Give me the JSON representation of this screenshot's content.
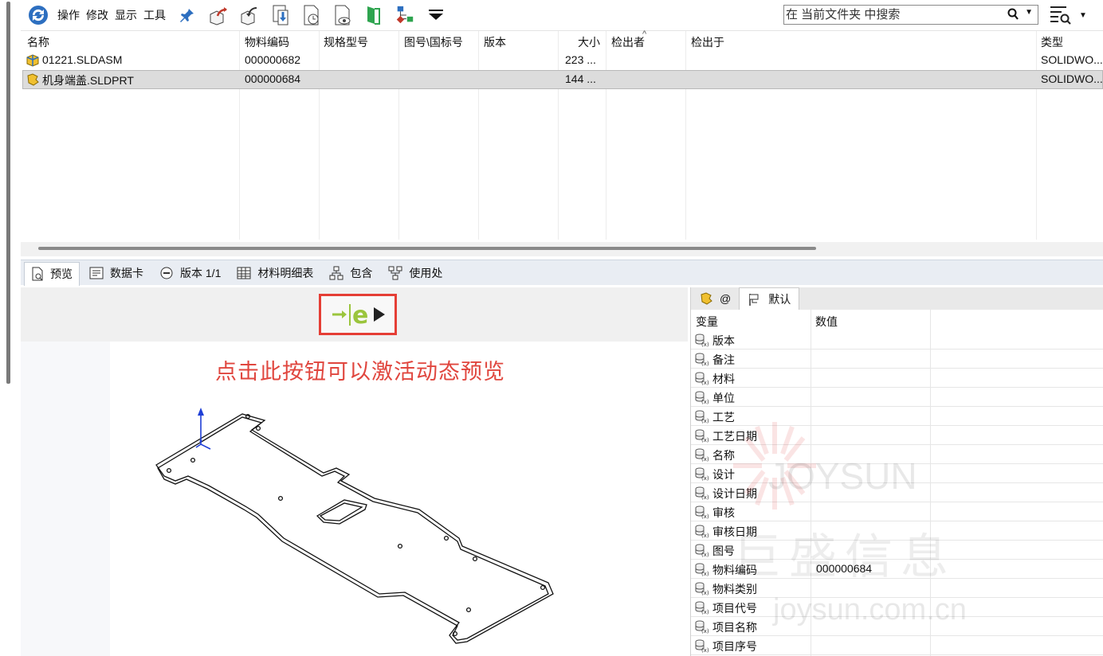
{
  "toolbar": {
    "menus": [
      "操作",
      "修改",
      "显示",
      "工具"
    ],
    "search_placeholder": "在 当前文件夹 中搜索"
  },
  "filelist": {
    "columns": [
      "名称",
      "物料编码",
      "规格型号",
      "图号\\国标号",
      "版本",
      "大小",
      "检出者",
      "检出于",
      "类型"
    ],
    "rows": [
      {
        "name": "01221.SLDASM",
        "code": "000000682",
        "size": "223 ...",
        "type": "SOLIDWO..."
      },
      {
        "name": "机身端盖.SLDPRT",
        "code": "000000684",
        "size": "144 ...",
        "type": "SOLIDWO..."
      }
    ]
  },
  "tabs": [
    "预览",
    "数据卡",
    "版本 1/1",
    "材料明细表",
    "包含",
    "使用处"
  ],
  "preview": {
    "annotation": "点击此按钮可以激活动态预览"
  },
  "props": {
    "tabs": [
      "@",
      "默认"
    ],
    "headers": [
      "变量",
      "数值"
    ],
    "rows": [
      {
        "name": "版本",
        "value": ""
      },
      {
        "name": "备注",
        "value": ""
      },
      {
        "name": "材料",
        "value": ""
      },
      {
        "name": "单位",
        "value": ""
      },
      {
        "name": "工艺",
        "value": ""
      },
      {
        "name": "工艺日期",
        "value": ""
      },
      {
        "name": "名称",
        "value": ""
      },
      {
        "name": "设计",
        "value": ""
      },
      {
        "name": "设计日期",
        "value": ""
      },
      {
        "name": "审核",
        "value": ""
      },
      {
        "name": "审核日期",
        "value": ""
      },
      {
        "name": "图号",
        "value": ""
      },
      {
        "name": "物料编码",
        "value": "000000684"
      },
      {
        "name": "物料类别",
        "value": ""
      },
      {
        "name": "项目代号",
        "value": ""
      },
      {
        "name": "项目名称",
        "value": ""
      },
      {
        "name": "项目序号",
        "value": ""
      }
    ]
  },
  "watermark": {
    "brand": "JOYSUN",
    "cn": "巨盛信息",
    "url": "joysun.com.cn"
  },
  "colors": {
    "accent_red": "#e53e35",
    "tab_bg": "#e9edf3",
    "selected_row": "#dcdcdc"
  }
}
